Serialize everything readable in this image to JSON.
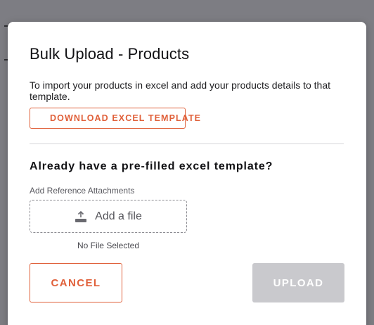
{
  "modal": {
    "title": "Bulk Upload - Products",
    "description": "To import your products in excel and add your products details to that template.",
    "download_button_label": "DOWNLOAD EXCEL TEMPLATE",
    "section_heading": "Already have a pre-filled excel template?",
    "attachments_label": "Add Reference Attachments",
    "file_input": {
      "label": "Add a file",
      "icon": "upload-icon",
      "status": "No File Selected"
    },
    "cancel_label": "CANCEL",
    "upload_label": "UPLOAD",
    "upload_enabled": false
  },
  "colors": {
    "accent": "#e0603a",
    "disabled": "#c9c9cd",
    "overlay": "#7d7d83"
  }
}
